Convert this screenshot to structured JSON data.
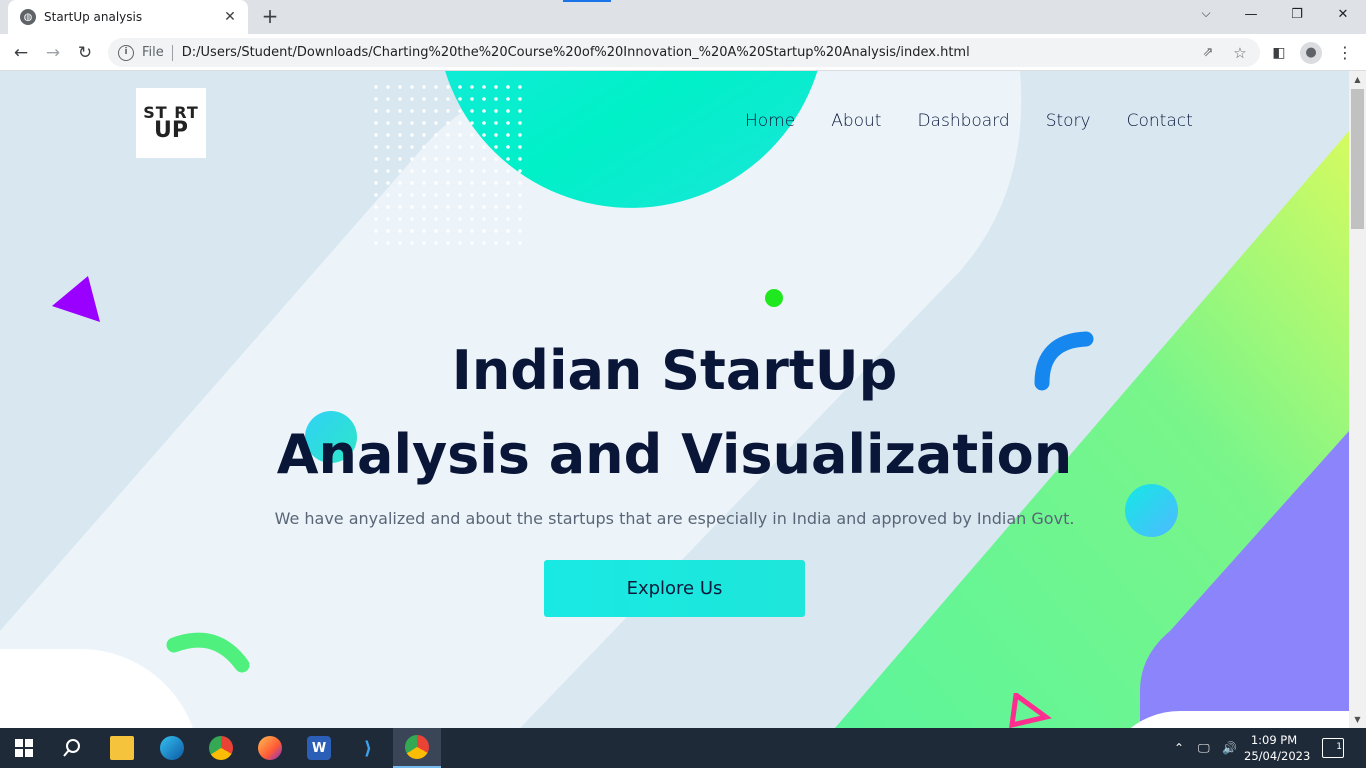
{
  "browser": {
    "tab_title": "StartUp analysis",
    "tab_close": "✕",
    "new_tab": "+",
    "scheme_label": "File",
    "url": "D:/Users/Student/Downloads/Charting%20the%20Course%20of%20Innovation_%20A%20Startup%20Analysis/index.html",
    "icons": [
      "globe-icon",
      "close-icon",
      "plus-icon",
      "chevron-down-icon",
      "minimize-icon",
      "restore-icon",
      "back-icon",
      "forward-icon",
      "reload-icon",
      "info-icon",
      "share-icon",
      "star-icon",
      "side-panel-icon",
      "profile-icon",
      "menu-icon"
    ]
  },
  "page": {
    "logo": {
      "line1": "ST RT",
      "line2": "UP"
    },
    "nav": [
      "Home",
      "About",
      "Dashboard",
      "Story",
      "Contact"
    ],
    "hero": {
      "title_line1": "Indian StartUp",
      "title_line2": "Analysis and Visualization",
      "subtitle": "We have anyalized and about the startups that are especially in India and approved by Indian Govt.",
      "cta": "Explore Us"
    },
    "colors": {
      "title": "#0a1638",
      "accent_cyan": "#19e9e3",
      "accent_green": "#1fe81f",
      "accent_purple": "#8b84fa",
      "background": "#d9e7f1"
    }
  },
  "taskbar": {
    "apps": [
      "windows-start-icon",
      "search-icon",
      "file-explorer-icon",
      "edge-icon",
      "chrome-icon",
      "firefox-icon",
      "word-icon",
      "vscode-icon",
      "chrome-active-icon"
    ],
    "time": "1:09 PM",
    "date": "25/04/2023",
    "notification_count": "1"
  }
}
